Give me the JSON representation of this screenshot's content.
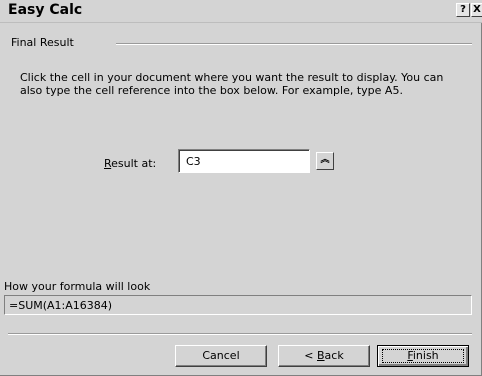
{
  "window": {
    "title": "Easy Calc",
    "help_glyph": "?",
    "close_glyph": "X"
  },
  "section": {
    "label": "Final Result"
  },
  "instructions": "Click the cell in your document where you want the result to display.  You can also type the cell reference into the box below. For example, type A5.",
  "result": {
    "label_accel": "R",
    "label_rest": "esult at:",
    "value": "C3",
    "collapse_glyph": "︽"
  },
  "formula": {
    "label": "How your formula will look",
    "value": "=SUM(A1:A16384)"
  },
  "buttons": {
    "cancel": "Cancel",
    "back_prefix": "< ",
    "back_accel": "B",
    "back_rest": "ack",
    "finish_accel": "F",
    "finish_rest": "inish"
  }
}
